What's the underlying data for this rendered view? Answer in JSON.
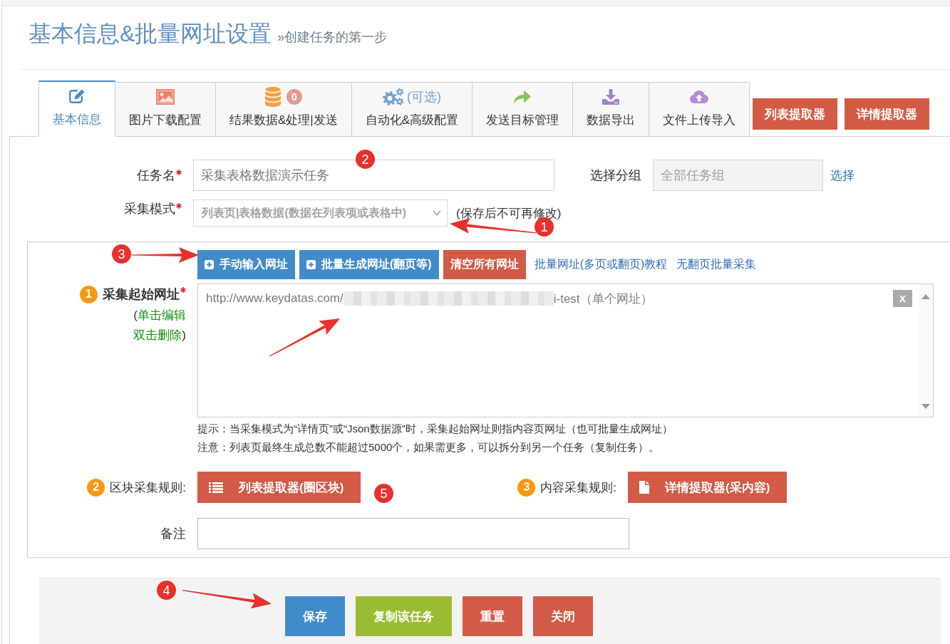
{
  "header": {
    "title": "基本信息&批量网址设置",
    "subtitle": "»创建任务的第一步"
  },
  "tabs": [
    {
      "label": "基本信息",
      "selected": true
    },
    {
      "label": "图片下载配置",
      "selected": false
    },
    {
      "label": "结果数据&处理|发送",
      "badge": "0",
      "selected": false
    },
    {
      "label": "自动化&高级配置",
      "note": "(可选)",
      "selected": false
    },
    {
      "label": "发送目标管理",
      "selected": false
    },
    {
      "label": "数据导出",
      "selected": false
    },
    {
      "label": "文件上传导入",
      "selected": false
    }
  ],
  "tab_buttons": [
    "列表提取器",
    "详情提取器"
  ],
  "task_name": {
    "label": "任务名",
    "required": true,
    "value": "采集表格数据演示任务"
  },
  "group": {
    "label": "选择分组",
    "value": "全部任务组",
    "disabled": true,
    "link": "选择"
  },
  "mode": {
    "label": "采集模式",
    "required": true,
    "value": "列表页|表格数据(数据在列表项或表格中)",
    "note": "(保存后不可再修改)"
  },
  "url_section": {
    "buttons": [
      {
        "label": "手动输入网址",
        "kind": "primary"
      },
      {
        "label": "批量生成网址(翻页等)",
        "kind": "primary"
      },
      {
        "label": "清空所有网址",
        "kind": "danger"
      }
    ],
    "links": [
      "批量网址(多页或翻页)教程",
      "无翻页批量采集"
    ],
    "start_url": {
      "step": "1",
      "label": "采集起始网址",
      "required": true,
      "hint": {
        "open": "(",
        "lines": [
          "单击编辑",
          "双击删除"
        ],
        "close": ")"
      },
      "items": [
        {
          "prefix": "http://www.keydatas.com/",
          "suffix": "i-test（单个网址）",
          "remove": "x"
        }
      ]
    },
    "notes": [
      "提示：当采集模式为“详情页”或“Json数据源”时，采集起始网址则指内容页网址（也可批量生成网址）",
      "注意：列表页最终生成总数不能超过5000个，如果需更多，可以拆分到另一个任务（复制任务）。"
    ],
    "rules": [
      {
        "step": "2",
        "label": "区块采集规则:",
        "button": "列表提取器(圈区块)"
      },
      {
        "step": "3",
        "label": "内容采集规则:",
        "button": "详情提取器(采内容)"
      }
    ],
    "remark": {
      "label": "备注"
    }
  },
  "actions": [
    {
      "label": "保存",
      "kind": "primary"
    },
    {
      "label": "复制该任务",
      "kind": "success"
    },
    {
      "label": "重置",
      "kind": "danger"
    },
    {
      "label": "关闭",
      "kind": "danger"
    }
  ],
  "callouts": [
    "2",
    "1",
    "3",
    "5",
    "4"
  ]
}
